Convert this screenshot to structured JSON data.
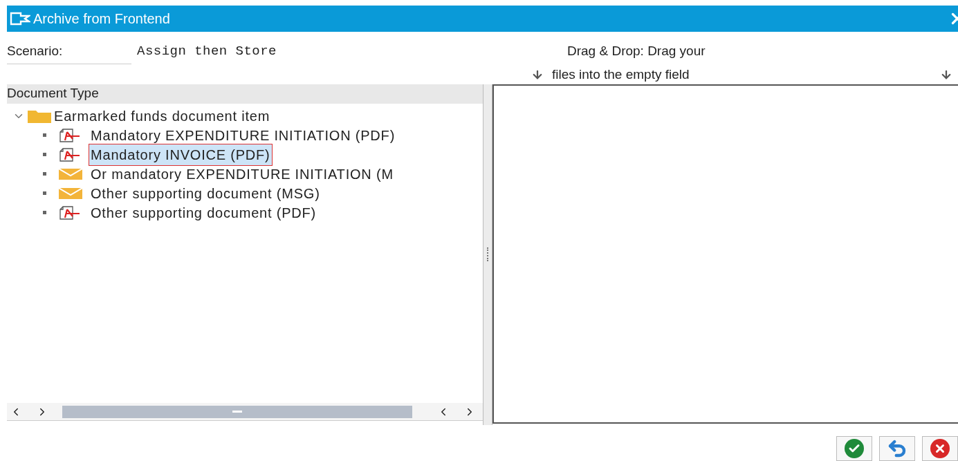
{
  "window": {
    "title": "Archive from Frontend"
  },
  "scenario": {
    "label": "Scenario:",
    "value": "Assign then Store"
  },
  "drop_hint": {
    "line_1": "Drag & Drop: Drag your",
    "line_2": "files into the empty field"
  },
  "tree": {
    "header": "Document Type",
    "root": {
      "label": "Earmarked funds document item",
      "expanded": true,
      "children": [
        {
          "label": "Mandatory EXPENDITURE INITIATION (PDF)",
          "kind": "pdf",
          "selected": false
        },
        {
          "label": "Mandatory INVOICE (PDF)",
          "kind": "pdf",
          "selected": true
        },
        {
          "label": "Or mandatory EXPENDITURE INITIATION (M",
          "kind": "msg",
          "selected": false
        },
        {
          "label": "Other supporting document (MSG)",
          "kind": "msg",
          "selected": false
        },
        {
          "label": "Other supporting document (PDF)",
          "kind": "pdf",
          "selected": false
        }
      ]
    }
  },
  "buttons": [
    {
      "kind": "confirm"
    },
    {
      "kind": "undo"
    },
    {
      "kind": "cancel"
    }
  ]
}
